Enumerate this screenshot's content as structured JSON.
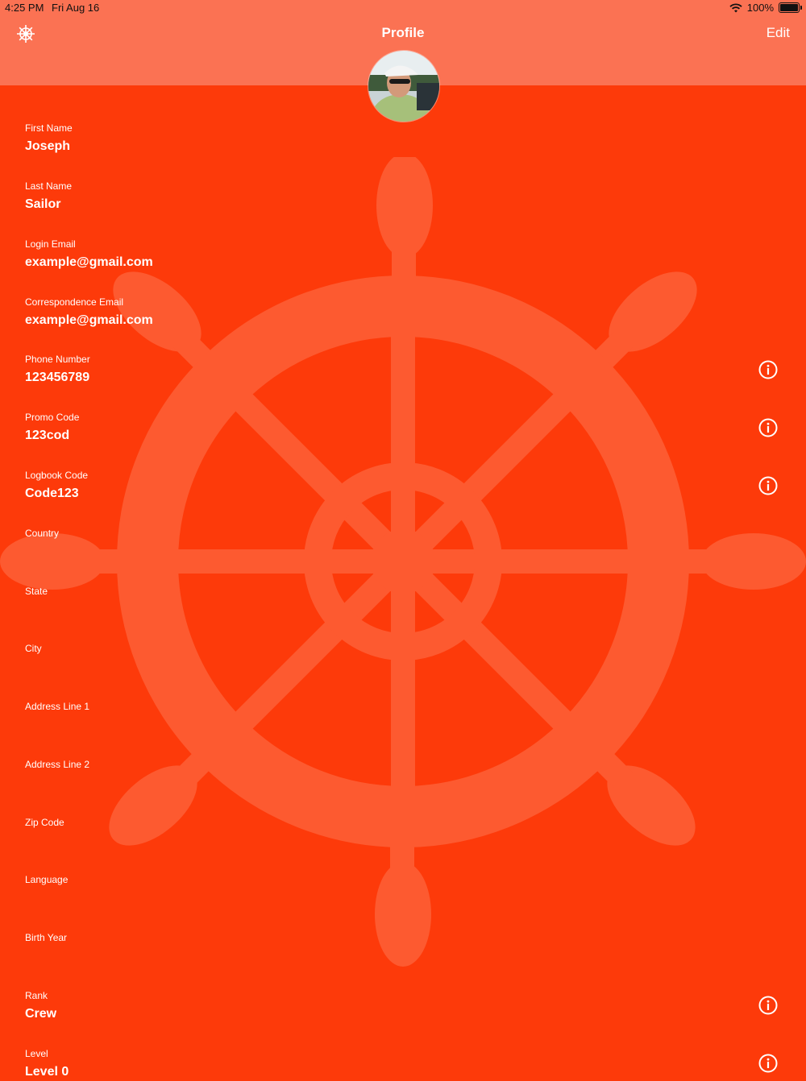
{
  "status": {
    "time": "4:25 PM",
    "date": "Fri Aug 16",
    "battery": "100%"
  },
  "header": {
    "title": "Profile",
    "edit_label": "Edit",
    "background": "#fb7253"
  },
  "theme": {
    "background": "#fd3a0a",
    "wheel_color": "#fd5a30"
  },
  "fields": [
    {
      "label": "First Name",
      "value": "Joseph"
    },
    {
      "label": "Last Name",
      "value": "Sailor"
    },
    {
      "label": "Login Email",
      "value": "example@gmail.com"
    },
    {
      "label": "Correspondence Email",
      "value": "example@gmail.com"
    },
    {
      "label": "Phone Number",
      "value": "123456789",
      "info": true
    },
    {
      "label": "Promo Code",
      "value": "123cod",
      "info": true
    },
    {
      "label": "Logbook Code",
      "value": "Code123",
      "info": true
    },
    {
      "label": "Country",
      "value": ""
    },
    {
      "label": "State",
      "value": ""
    },
    {
      "label": "City",
      "value": ""
    },
    {
      "label": "Address Line 1",
      "value": ""
    },
    {
      "label": "Address Line 2",
      "value": ""
    },
    {
      "label": "Zip Code",
      "value": ""
    },
    {
      "label": "Language",
      "value": ""
    },
    {
      "label": "Birth Year",
      "value": ""
    },
    {
      "label": "Rank",
      "value": "Crew",
      "info": true
    },
    {
      "label": "Level",
      "value": "Level 0",
      "info": true
    }
  ],
  "icons": {
    "settings": "ship-wheel-icon",
    "info": "info-icon",
    "background": "ship-wheel-watermark"
  }
}
